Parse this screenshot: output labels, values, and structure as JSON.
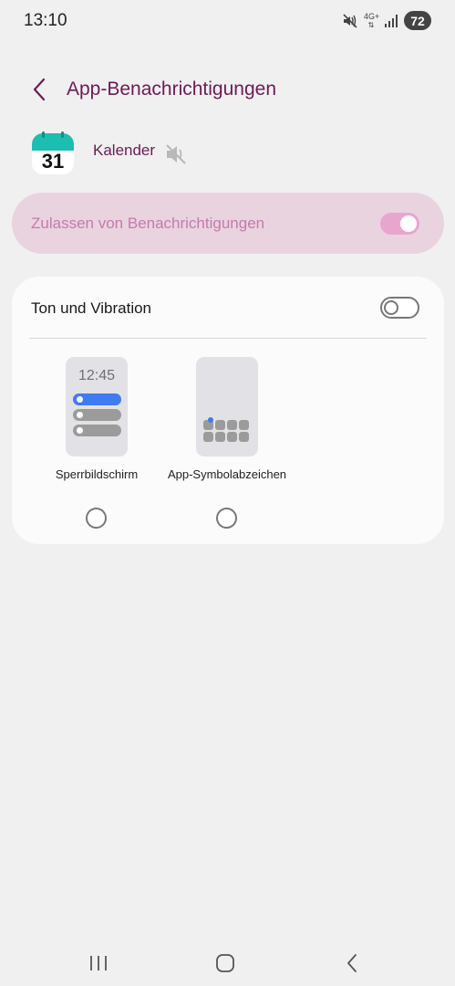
{
  "status_bar": {
    "time": "13:10",
    "network_label": "4G+",
    "battery": "72",
    "icons": [
      "mute-vibrate-icon",
      "network-activity-icon",
      "signal-icon",
      "battery-icon"
    ]
  },
  "header": {
    "title": "App-Benachrichtigungen",
    "back_icon": "chevron-left-icon"
  },
  "app": {
    "icon_day": "31",
    "name": "Kalender",
    "mute_icon": "muted-speaker-icon"
  },
  "allow": {
    "label": "Zulassen von Benachrichtigungen",
    "enabled": true
  },
  "sound": {
    "label": "Ton und Vibration",
    "enabled": false
  },
  "options": [
    {
      "label": "Sperrbildschirm",
      "preview_time": "12:45",
      "selected": false
    },
    {
      "label": "App-Symbolabzeichen",
      "selected": false
    }
  ],
  "nav": {
    "icons": [
      "recent-apps-icon",
      "home-icon",
      "back-icon"
    ]
  },
  "colors": {
    "accent": "#6e1a56",
    "allow_card_bg": "#e9d3df",
    "allow_label": "#c67aac",
    "toggle_on": "#e8a6cf",
    "calendar_teal": "#1cbeb0",
    "preview_blue": "#3e7cf0"
  }
}
